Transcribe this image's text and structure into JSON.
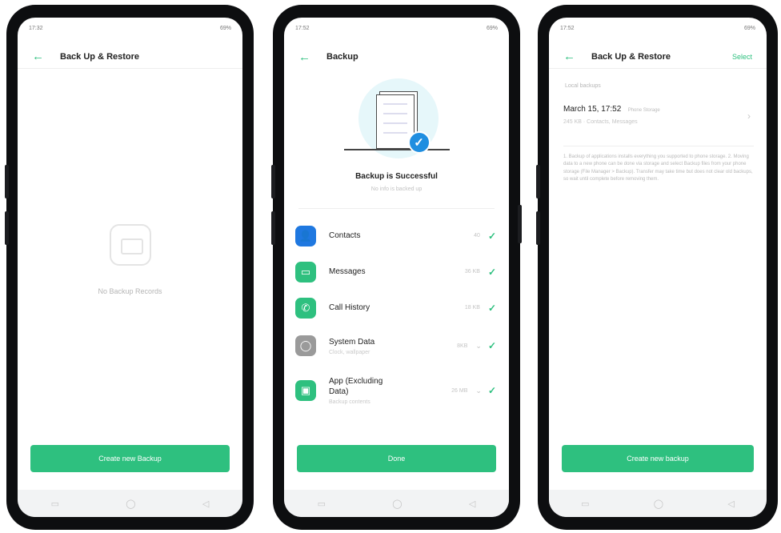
{
  "phone1": {
    "status": {
      "time": "17:32",
      "right": "69%"
    },
    "title": "Back Up & Restore",
    "empty_text": "No Backup Records",
    "cta": "Create new Backup"
  },
  "phone2": {
    "status": {
      "time": "17:52",
      "right": "69%"
    },
    "title": "Backup",
    "success": "Backup is Successful",
    "success_sub": "No info is backed up",
    "items": [
      {
        "name": "Contacts",
        "sub": "",
        "value": "40",
        "color": "#1f78e0",
        "icon": "contacts-icon",
        "glyph": "👤",
        "arrow": false
      },
      {
        "name": "Messages",
        "sub": "",
        "value": "36 KB",
        "color": "#2ec07f",
        "icon": "messages-icon",
        "glyph": "💬",
        "arrow": false
      },
      {
        "name": "Call History",
        "sub": "",
        "value": "18 KB",
        "color": "#2ec07f",
        "icon": "call-history-icon",
        "glyph": "✆",
        "arrow": false
      },
      {
        "name": "System Data",
        "sub": "Clock, wallpaper",
        "value": "8KB",
        "color": "#9a9a9a",
        "icon": "system-data-icon",
        "glyph": "◯",
        "arrow": true
      },
      {
        "name": "App (Excluding Data)",
        "sub": "Backup contents",
        "value": "26 MB",
        "color": "#2ec07f",
        "icon": "app-icon",
        "glyph": "▣",
        "arrow": true
      }
    ],
    "cta": "Done"
  },
  "phone3": {
    "status": {
      "time": "17:52",
      "right": "69%"
    },
    "title": "Back Up & Restore",
    "select": "Select",
    "date_group": "Local backups",
    "record_title": "March 15, 17:52",
    "record_tag": "Phone Storage",
    "record_sub": "245 KB · Contacts, Messages",
    "notes": "1. Backup of applications installs everything you supported to phone storage. 2. Moving data to a new phone can be done via storage and select Backup files from your phone storage (File Manager > Backup). Transfer may take time but does not clear old backups, so wait until complete before removing them.",
    "cta": "Create new backup"
  },
  "nav": {
    "left": "▭",
    "home": "◯",
    "back": "◁"
  },
  "colors": {
    "accent": "#2ec07f",
    "blue": "#1f8ee0"
  }
}
